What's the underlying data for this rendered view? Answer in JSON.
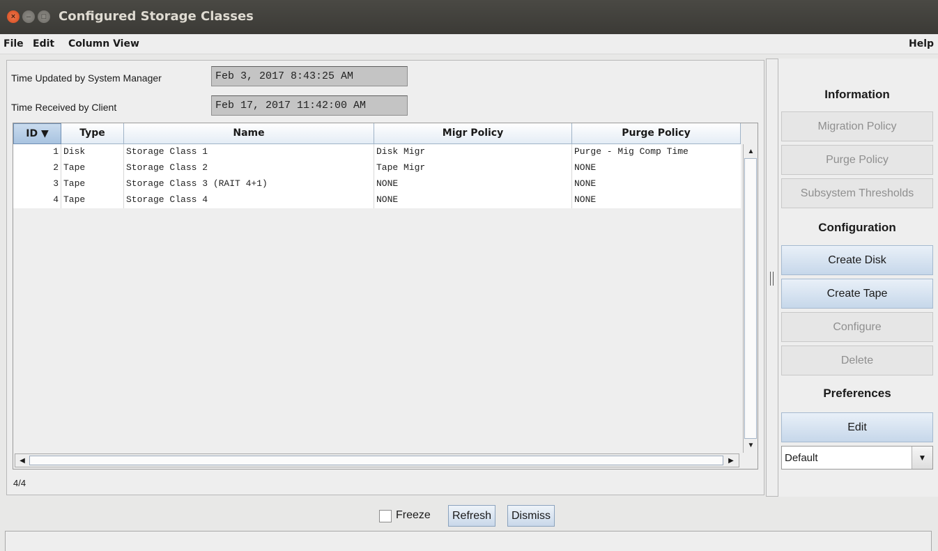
{
  "window": {
    "title": "Configured Storage Classes"
  },
  "menu": {
    "file": "File",
    "edit": "Edit",
    "column_view": "Column View",
    "help": "Help"
  },
  "timestamps": {
    "updated_label": "Time Updated by System Manager",
    "updated_value": "Feb 3, 2017 8:43:25 AM",
    "received_label": "Time Received by Client",
    "received_value": "Feb 17, 2017 11:42:00 AM"
  },
  "table": {
    "headers": {
      "id": "ID ▼",
      "type": "Type",
      "name": "Name",
      "migr": "Migr Policy",
      "purge": "Purge Policy"
    },
    "rows": [
      {
        "id": "1",
        "type": "Disk",
        "name": "Storage Class 1",
        "migr": "Disk Migr",
        "purge": "Purge - Mig Comp Time"
      },
      {
        "id": "2",
        "type": "Tape",
        "name": "Storage Class 2",
        "migr": "Tape Migr",
        "purge": "NONE"
      },
      {
        "id": "3",
        "type": "Tape",
        "name": "Storage Class 3 (RAIT 4+1)",
        "migr": "NONE",
        "purge": "NONE"
      },
      {
        "id": "4",
        "type": "Tape",
        "name": "Storage Class 4",
        "migr": "NONE",
        "purge": "NONE"
      }
    ],
    "count": "4/4"
  },
  "sidebar": {
    "information": "Information",
    "migration_policy": "Migration Policy",
    "purge_policy": "Purge Policy",
    "subsystem_thresholds": "Subsystem Thresholds",
    "configuration": "Configuration",
    "create_disk": "Create Disk",
    "create_tape": "Create Tape",
    "configure": "Configure",
    "delete": "Delete",
    "preferences": "Preferences",
    "edit": "Edit",
    "preference_select": "Default"
  },
  "bottom": {
    "freeze": "Freeze",
    "refresh": "Refresh",
    "dismiss": "Dismiss"
  },
  "icons": {
    "close": "close-icon",
    "minimize": "minimize-icon",
    "maximize": "maximize-icon",
    "scroll_up": "arrow-up-icon",
    "scroll_down": "arrow-down-icon",
    "scroll_left": "arrow-left-icon",
    "scroll_right": "arrow-right-icon",
    "dropdown": "chevron-down-icon"
  }
}
